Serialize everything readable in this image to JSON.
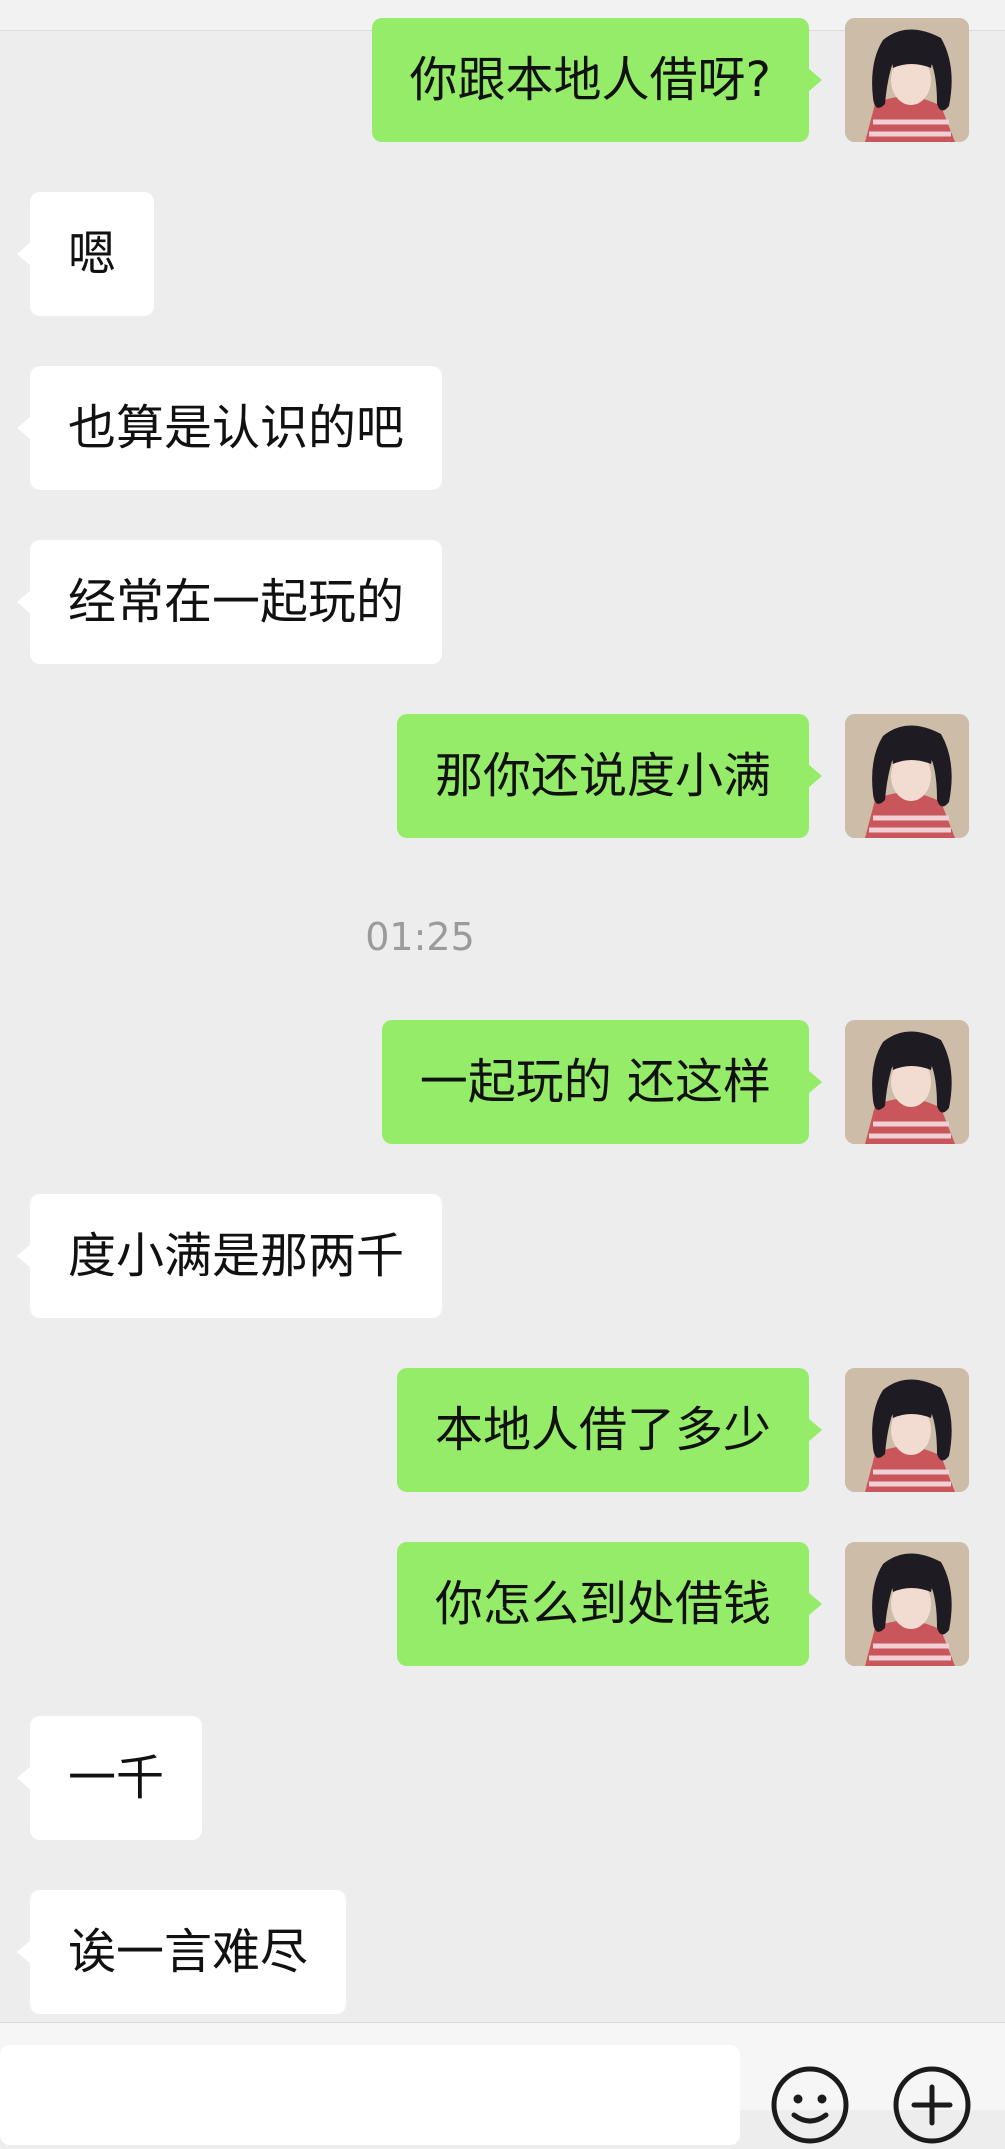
{
  "messages": [
    {
      "side": "right",
      "text": "你跟本地人借呀?"
    },
    {
      "side": "left",
      "text": "嗯"
    },
    {
      "side": "left",
      "text": "也算是认识的吧"
    },
    {
      "side": "left",
      "text": "经常在一起玩的"
    },
    {
      "side": "right",
      "text": "那你还说度小满"
    },
    {
      "side": "right",
      "text": "一起玩的 还这样"
    },
    {
      "side": "left",
      "text": "度小满是那两千"
    },
    {
      "side": "right",
      "text": "本地人借了多少"
    },
    {
      "side": "right",
      "text": "你怎么到处借钱"
    },
    {
      "side": "left",
      "text": "一千"
    },
    {
      "side": "left",
      "text": "诶一言难尽"
    }
  ],
  "timestamp": "01:25",
  "colors": {
    "background": "#ededed",
    "sent_bubble": "#95ec69",
    "received_bubble": "#ffffff"
  },
  "bottom_bar": {
    "icons": [
      "emoji-icon",
      "plus-icon"
    ]
  }
}
